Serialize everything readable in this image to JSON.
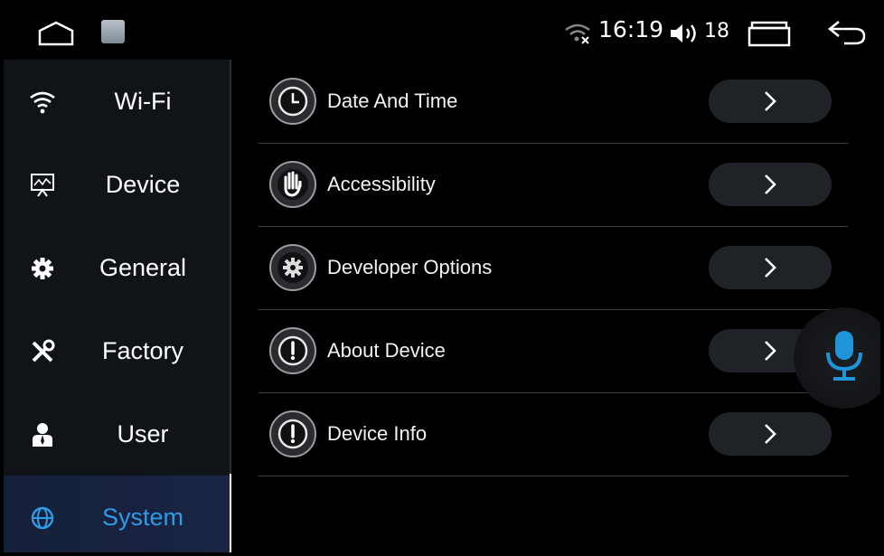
{
  "status_bar": {
    "time": "16:19",
    "volume_level": "18",
    "icons": [
      "home-icon",
      "settings-app-icon",
      "wifi-disconnected-icon",
      "volume-icon",
      "recent-apps-icon",
      "back-icon"
    ]
  },
  "sidebar": {
    "items": [
      {
        "label": "Wi-Fi",
        "icon": "wifi-icon",
        "active": false
      },
      {
        "label": "Device",
        "icon": "device-icon",
        "active": false
      },
      {
        "label": "General",
        "icon": "gear-icon",
        "active": false
      },
      {
        "label": "Factory",
        "icon": "tools-icon",
        "active": false
      },
      {
        "label": "User",
        "icon": "user-icon",
        "active": false
      },
      {
        "label": "System",
        "icon": "globe-icon",
        "active": true
      }
    ]
  },
  "main": {
    "rows": [
      {
        "label": "Date And Time",
        "icon": "clock-icon"
      },
      {
        "label": "Accessibility",
        "icon": "hand-icon"
      },
      {
        "label": "Developer Options",
        "icon": "gear-icon"
      },
      {
        "label": "About Device",
        "icon": "info-icon"
      },
      {
        "label": "Device Info",
        "icon": "info-icon"
      }
    ]
  },
  "floating": {
    "icon": "microphone-icon"
  },
  "colors": {
    "accent": "#2f9be6",
    "sidebar_bg": "#101419",
    "divider": "#3a3d42",
    "mic": "#1f94d9"
  }
}
